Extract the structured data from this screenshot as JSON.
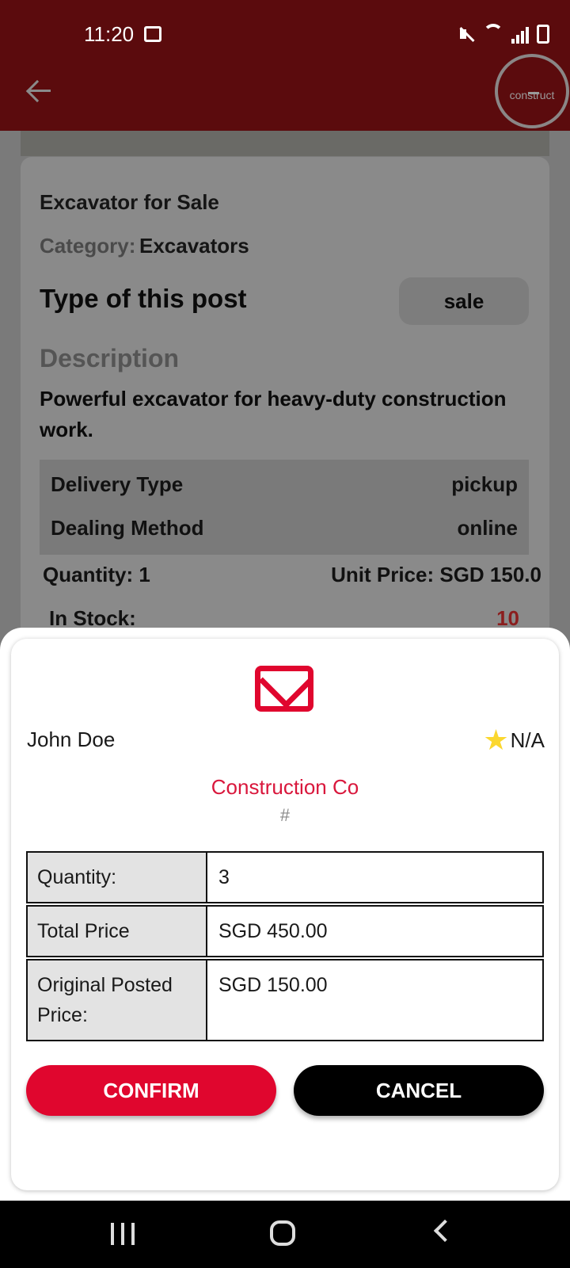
{
  "status_bar": {
    "time": "11:20"
  },
  "app_bar": {
    "logo_text": "construct"
  },
  "post": {
    "title": "Excavator for Sale",
    "category_label": "Category:",
    "category_value": "Excavators",
    "type_label": "Type of this post",
    "type_value": "sale",
    "description_label": "Description",
    "description_text": "Powerful excavator for heavy-duty construction work.",
    "delivery_type_label": "Delivery Type",
    "delivery_type_value": "pickup",
    "dealing_method_label": "Dealing Method",
    "dealing_method_value": "online",
    "quantity_text": "Quantity:  1",
    "unit_price_text": "Unit Price: SGD 150.0",
    "in_stock_label": "In Stock:",
    "in_stock_value": "10"
  },
  "dialog": {
    "seller_name": "John Doe",
    "rating": "N/A",
    "company": "Construction Co",
    "company_sub": "#",
    "table": [
      {
        "key": "Quantity:",
        "value": "3"
      },
      {
        "key": "Total Price",
        "value": "SGD 450.00"
      },
      {
        "key": "Original Posted Price:",
        "value": "SGD 150.00"
      }
    ],
    "confirm_label": "CONFIRM",
    "cancel_label": "CANCEL"
  },
  "colors": {
    "accent": "#e0062e",
    "appbar": "#5b0b0d",
    "star": "#fbd72f"
  }
}
